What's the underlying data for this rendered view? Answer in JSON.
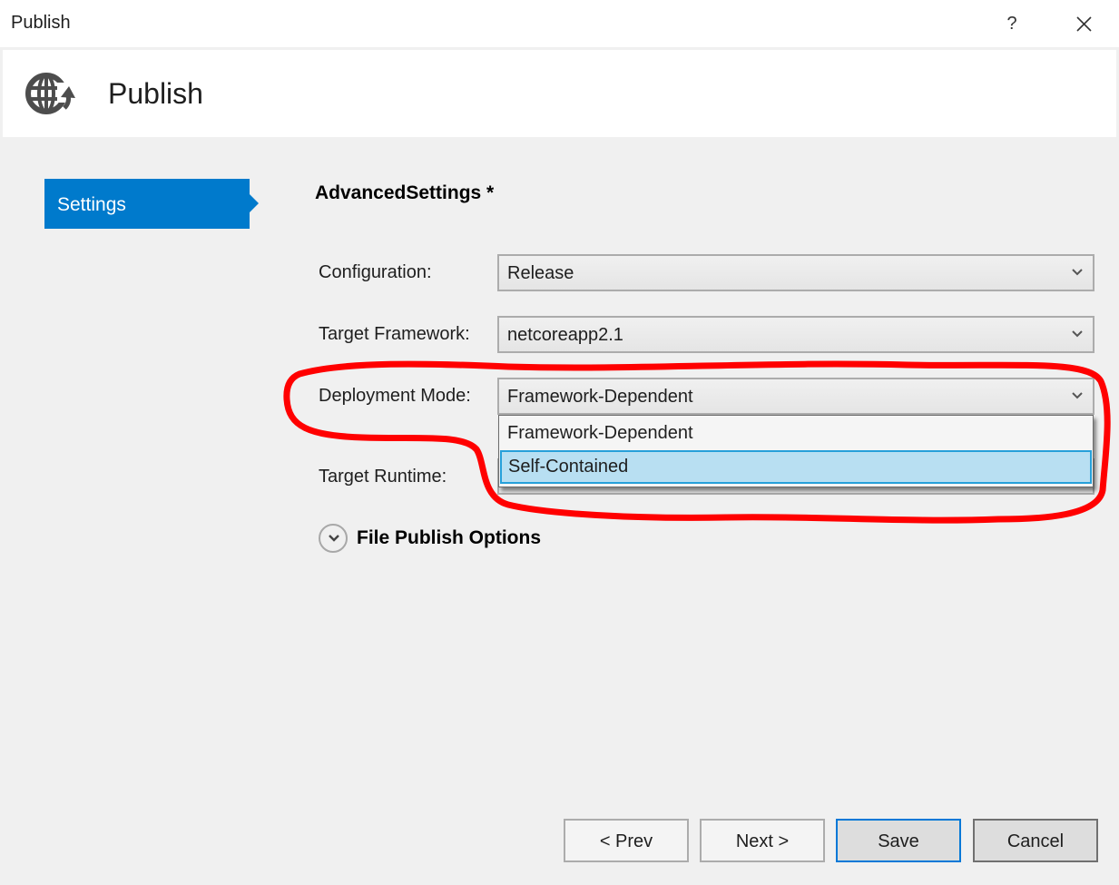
{
  "window": {
    "title": "Publish",
    "help_label": "?",
    "close_icon": "close-icon"
  },
  "header": {
    "title": "Publish",
    "icon": "globe-publish-icon"
  },
  "sidebar": {
    "items": [
      {
        "label": "Settings",
        "selected": true
      }
    ]
  },
  "main": {
    "section_title": "AdvancedSettings *",
    "fields": {
      "configuration": {
        "label": "Configuration:",
        "value": "Release"
      },
      "target_framework": {
        "label": "Target Framework:",
        "value": "netcoreapp2.1"
      },
      "deployment_mode": {
        "label": "Deployment Mode:",
        "value": "Framework-Dependent",
        "options": [
          "Framework-Dependent",
          "Self-Contained"
        ],
        "highlighted_option": "Self-Contained",
        "expanded": true
      },
      "target_runtime": {
        "label": "Target Runtime:",
        "value": ""
      }
    },
    "expander": {
      "label": "File Publish Options",
      "expanded": false
    }
  },
  "footer": {
    "prev_label": "< Prev",
    "next_label": "Next >",
    "save_label": "Save",
    "cancel_label": "Cancel"
  },
  "colors": {
    "accent": "#007acc",
    "selection_bg": "#b8dff2",
    "selection_border": "#26a0da",
    "annotation": "#ff0000"
  }
}
